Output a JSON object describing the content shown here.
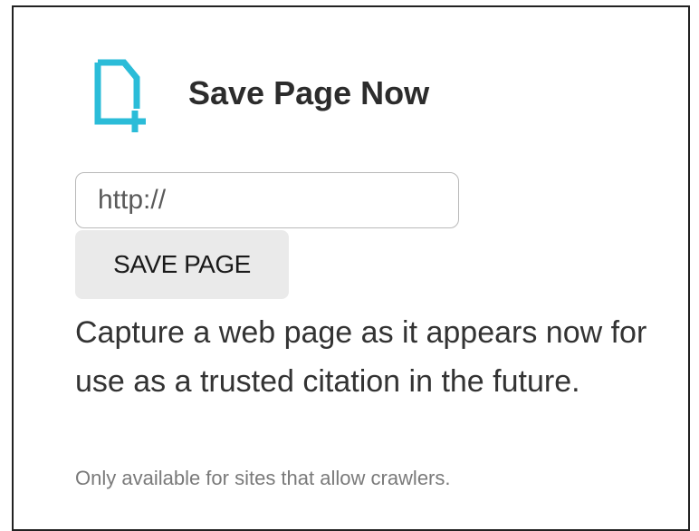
{
  "panel": {
    "title": "Save Page Now",
    "icon": "document-plus-icon",
    "icon_color": "#2bbcd8"
  },
  "url_input": {
    "placeholder": "http://",
    "value": ""
  },
  "save_button": {
    "label": "SAVE PAGE"
  },
  "description": "Capture a web page as it appears now for use as a trusted citation in the future.",
  "note": "Only available for sites that allow crawlers.",
  "colors": {
    "title_text": "#2c2c2c",
    "button_bg": "#eaeaea",
    "note_text": "#7a7a7a",
    "border": "#222222"
  }
}
